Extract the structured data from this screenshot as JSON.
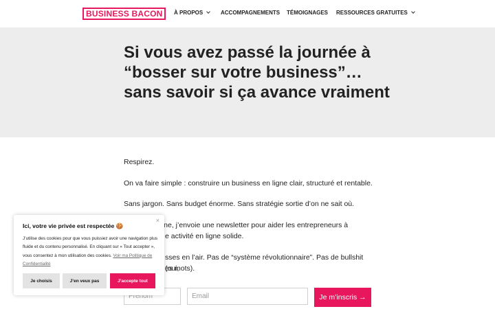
{
  "header": {
    "logo": "BUSINESS BACON",
    "nav": [
      {
        "label": "À PROPOS"
      },
      {
        "label": "ACCOMPAGNEMENTS"
      },
      {
        "label": "TÉMOIGNAGES"
      },
      {
        "label": "RESSOURCES GRATUITES"
      }
    ]
  },
  "hero": {
    "title": "Si vous avez passé la journée à “bosser sur votre business”… sans savoir si ça avance vraiment"
  },
  "content": {
    "p1": "Respirez.",
    "p2": "On va faire simple : construire un business en ligne clair, structuré et rentable.",
    "p3": "Sans jargon. Sans budget énorme. Sans stratégie sortie d’on ne sait où.",
    "p4_line1": "nine, j’envoie une newsletter pour aider les entrepreneurs à",
    "p4_line2": "e activité en ligne solide.",
    "p5_line1": "sses en l’air. Pas de “système révolutionnaire”. Pas de bullshit (oui,",
    "p5_line2": "es mots)."
  },
  "form": {
    "firstname_placeholder": "Prénom",
    "email_placeholder": "Email",
    "submit_label": "Je m’inscris →"
  },
  "cookie": {
    "close": "×",
    "title": "Ici, votre vie privée est respectée 🍪",
    "text": "J’utilise des cookies pour que vous puissiez avoir une navigation plus fluide et du contenu personnalisé. En cliquant sur « Tout accepter », vous consentez à mon utilisation des cookies.",
    "link": "Voir ma Politique de Confidentialité",
    "btn_choose": "Je choisis",
    "btn_refuse": "J’en veux pas",
    "btn_accept": "J’accepte tout"
  },
  "colors": {
    "accent": "#e8175d",
    "hero_bg": "#ededed"
  }
}
